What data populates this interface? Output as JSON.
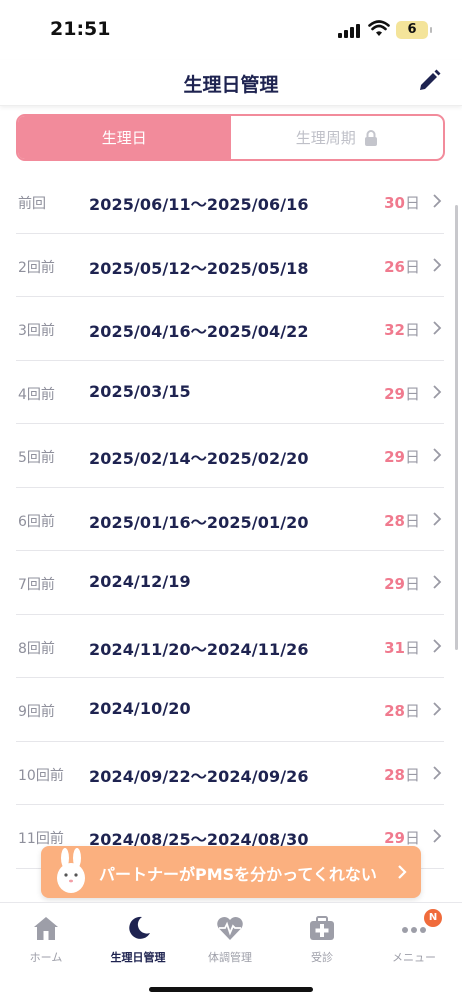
{
  "status": {
    "time": "21:51",
    "battery": "6"
  },
  "header": {
    "title": "生理日管理"
  },
  "segment": {
    "tab_active": "生理日",
    "tab_locked": "生理周期"
  },
  "records": [
    {
      "label": "前回",
      "date": "2025/06/11〜2025/06/16",
      "days": "30",
      "unit": "日"
    },
    {
      "label": "2回前",
      "date": "2025/05/12〜2025/05/18",
      "days": "26",
      "unit": "日"
    },
    {
      "label": "3回前",
      "date": "2025/04/16〜2025/04/22",
      "days": "32",
      "unit": "日"
    },
    {
      "label": "4回前",
      "date": "2025/03/15",
      "days": "29",
      "unit": "日"
    },
    {
      "label": "5回前",
      "date": "2025/02/14〜2025/02/20",
      "days": "29",
      "unit": "日"
    },
    {
      "label": "6回前",
      "date": "2025/01/16〜2025/01/20",
      "days": "28",
      "unit": "日"
    },
    {
      "label": "7回前",
      "date": "2024/12/19",
      "days": "29",
      "unit": "日"
    },
    {
      "label": "8回前",
      "date": "2024/11/20〜2024/11/26",
      "days": "31",
      "unit": "日"
    },
    {
      "label": "9回前",
      "date": "2024/10/20",
      "days": "28",
      "unit": "日"
    },
    {
      "label": "10回前",
      "date": "2024/09/22〜2024/09/26",
      "days": "28",
      "unit": "日"
    },
    {
      "label": "11回前",
      "date": "2024/08/25〜2024/08/30",
      "days": "29",
      "unit": "日"
    }
  ],
  "banner": {
    "text": "パートナーがPMSを分かってくれない"
  },
  "tabbar": {
    "items": [
      {
        "label": "ホーム",
        "icon": "home-icon"
      },
      {
        "label": "生理日管理",
        "icon": "moon-icon"
      },
      {
        "label": "体調管理",
        "icon": "heart-pulse-icon"
      },
      {
        "label": "受診",
        "icon": "medical-kit-icon"
      },
      {
        "label": "メニュー",
        "icon": "more-icon",
        "badge": "N"
      }
    ]
  },
  "colors": {
    "accent": "#f28b9b",
    "navy": "#1e2350",
    "banner": "#fbb07f",
    "badge": "#f06b3b"
  }
}
